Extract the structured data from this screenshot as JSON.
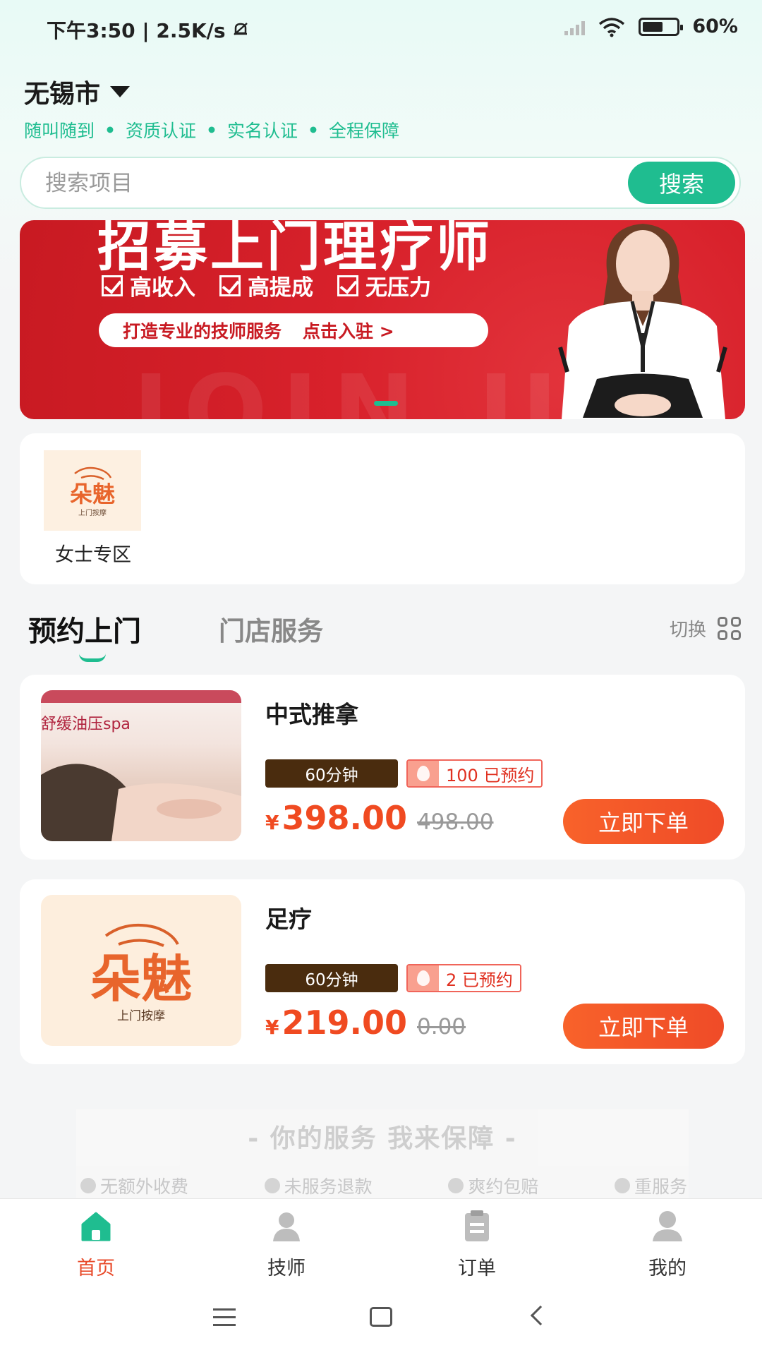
{
  "status_bar": {
    "time_speed": "下午3:50 | 2.5K/s",
    "battery": "60%"
  },
  "header": {
    "city": "无锡市",
    "features": [
      "随叫随到",
      "资质认证",
      "实名认证",
      "全程保障"
    ]
  },
  "search": {
    "placeholder": "搜索项目",
    "button": "搜索"
  },
  "banner": {
    "title": "招募上门理疗师",
    "checks": [
      "高收入",
      "高提成",
      "无压力"
    ],
    "pill_text": "打造专业的技师服务",
    "pill_cta": "点击入驻 >",
    "bg_text": "JOIN US"
  },
  "categories": [
    {
      "label": "女士专区",
      "logo_text": "朵魅",
      "logo_sub": "上门按摩"
    }
  ],
  "tabs": {
    "active": "预约上门",
    "other": "门店服务",
    "switch": "切换"
  },
  "services": [
    {
      "title": "中式推拿",
      "image_text": "舒缓油压spa",
      "duration": "60分钟",
      "booked": "100 已预约",
      "currency": "¥",
      "price": "398.00",
      "original_price": "498.00",
      "button": "立即下单"
    },
    {
      "title": "足疗",
      "image_text": "朵魅",
      "image_sub": "上门按摩",
      "duration": "60分钟",
      "booked": "2 已预约",
      "currency": "¥",
      "price": "219.00",
      "original_price": "0.00",
      "button": "立即下单"
    }
  ],
  "guarantee": {
    "title": "- 你的服务 我来保障 -",
    "items": [
      "无额外收费",
      "未服务退款",
      "爽约包赔",
      "重服务"
    ]
  },
  "bottom_nav": [
    {
      "label": "首页",
      "icon": "home-icon",
      "active": true
    },
    {
      "label": "技师",
      "icon": "technician-icon",
      "active": false
    },
    {
      "label": "订单",
      "icon": "order-icon",
      "active": false
    },
    {
      "label": "我的",
      "icon": "profile-icon",
      "active": false
    }
  ],
  "colors": {
    "accent": "#1fbd90",
    "price": "#f04a21",
    "banner_red": "#d8212b",
    "duration_bg": "#4a2c0e"
  }
}
